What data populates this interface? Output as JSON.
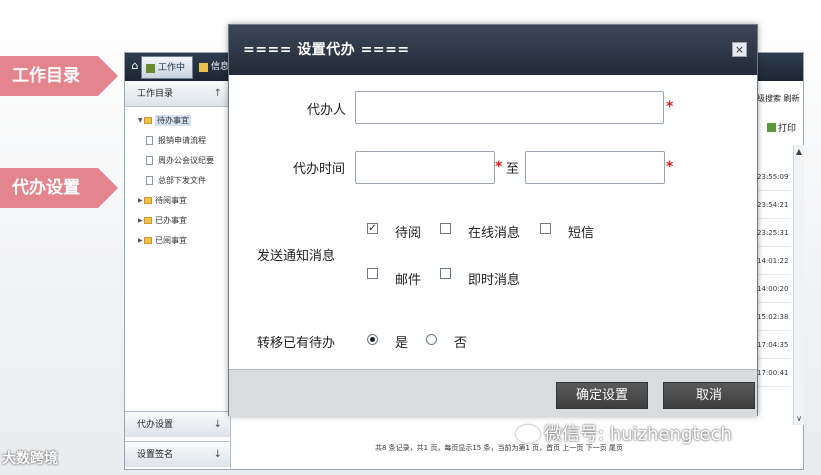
{
  "annotations": {
    "tag_work_dir": "工作目录",
    "tag_proxy": "代办设置"
  },
  "app": {
    "tabs": [
      {
        "label": "工作中心"
      },
      {
        "label": "信息中"
      }
    ],
    "sidebar": {
      "header": "工作目录",
      "tree": [
        {
          "label": "待办事宜"
        },
        {
          "label": "报销申请流程"
        },
        {
          "label": "周办公会议纪要"
        },
        {
          "label": "总部下发文件"
        },
        {
          "label": "待阅事宜"
        },
        {
          "label": "已办事宜"
        },
        {
          "label": "已阅事宜"
        }
      ],
      "footer_items": [
        {
          "label": "代办设置"
        },
        {
          "label": "设置签名"
        }
      ]
    },
    "right_tools": "级搜索  刷新",
    "print_label": "打印",
    "times": [
      "23:55:09",
      "23:54:21",
      "23:25:31",
      "14:01:22",
      "14:00:20",
      "15:02:38",
      "17:04:35",
      "17:00:41"
    ],
    "pager_text": "共8 条记录，共1 页，每页显示15 条，当前为第1 页，首页 上一页 下一页 尾页"
  },
  "modal": {
    "title": "==== 设置代办 ====",
    "close_symbol": "×",
    "fields": {
      "proxy_person_label": "代办人",
      "proxy_person_value": "",
      "proxy_time_label": "代办时间",
      "time_start_value": "",
      "time_to_label": "至",
      "time_end_value": "",
      "notify_label": "发送通知消息",
      "notify_options": [
        {
          "label": "待阅",
          "checked": true
        },
        {
          "label": "在线消息",
          "checked": false
        },
        {
          "label": "短信",
          "checked": false
        },
        {
          "label": "邮件",
          "checked": false
        },
        {
          "label": "即时消息",
          "checked": false
        }
      ],
      "transfer_label": "转移已有待办",
      "transfer_options": [
        {
          "label": "是",
          "selected": true
        },
        {
          "label": "否",
          "selected": false
        }
      ],
      "required_mark": "*"
    },
    "buttons": {
      "confirm": "确定设置",
      "cancel": "取消"
    }
  },
  "watermarks": {
    "left": "大数跨境",
    "right": "微信号: huizhengtech"
  },
  "colors": {
    "tag_bg": "#e4848c",
    "modal_header": "#2b3441",
    "required": "#d52020",
    "button_bg": "#484848"
  }
}
